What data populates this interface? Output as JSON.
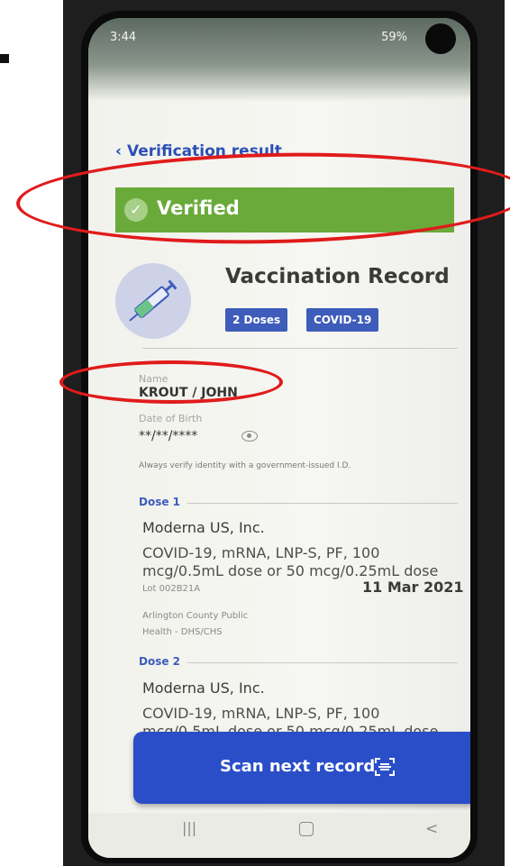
{
  "status_bar": {
    "time": "3:44",
    "battery": "59%"
  },
  "header": {
    "back_label": "Verification result"
  },
  "result": {
    "status": "Verified"
  },
  "record": {
    "title": "Vaccination Record",
    "badges": [
      "2 Doses",
      "COVID-19"
    ]
  },
  "person": {
    "name_label": "Name",
    "name": "KROUT / JOHN",
    "dob_label": "Date of Birth",
    "dob": "**/**/****",
    "notice": "Always verify identity with a government-issued I.D."
  },
  "doses": [
    {
      "header": "Dose 1",
      "manufacturer": "Moderna US, Inc.",
      "description": "COVID-19, mRNA, LNP-S, PF, 100 mcg/0.5mL dose or 50 mcg/0.25mL dose",
      "lot": "Lot 002B21A",
      "date": "11 Mar 2021",
      "location": "Arlington County Public Health - DHS/CHS"
    },
    {
      "header": "Dose 2",
      "manufacturer": "Moderna US, Inc.",
      "description": "COVID-19, mRNA, LNP-S, PF, 100 mcg/0.5mL dose or 50 mcg/0.25mL dose"
    }
  ],
  "actions": {
    "scan_label": "Scan next record"
  }
}
